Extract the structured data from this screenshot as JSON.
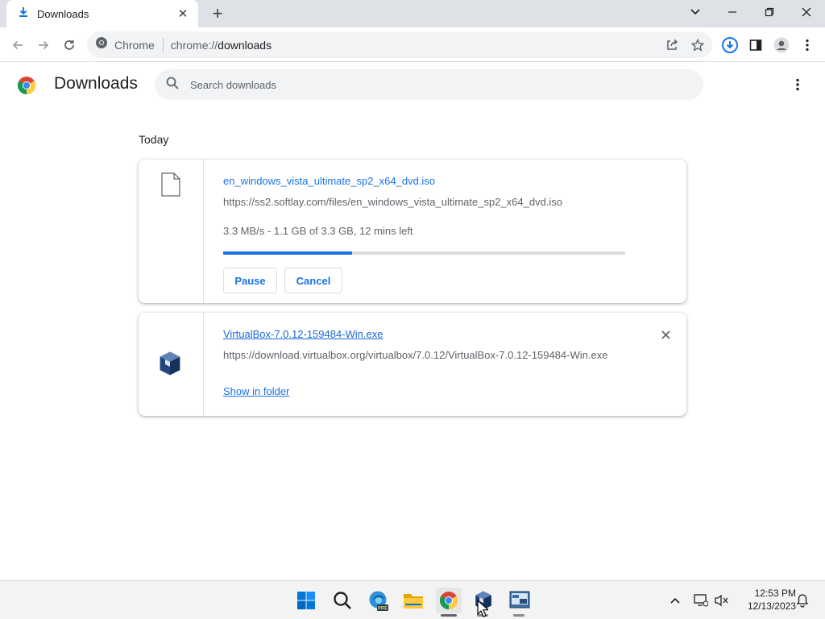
{
  "browser": {
    "tab": {
      "title": "Downloads"
    },
    "omnibox": {
      "site_chip": "Chrome",
      "url_scheme": "chrome://",
      "url_host": "downloads"
    }
  },
  "downloads_page": {
    "title": "Downloads",
    "search_placeholder": "Search downloads",
    "section_date": "Today",
    "items": [
      {
        "file_name": "en_windows_vista_ultimate_sp2_x64_dvd.iso",
        "url": "https://ss2.softlay.com/files/en_windows_vista_ultimate_sp2_x64_dvd.iso",
        "status": "3.3 MB/s - 1.1 GB of 3.3 GB, 12 mins left",
        "progress_fraction": 0.32,
        "pause_label": "Pause",
        "cancel_label": "Cancel",
        "icon": "generic-file-icon"
      },
      {
        "file_name": "VirtualBox-7.0.12-159484-Win.exe",
        "url": "https://download.virtualbox.org/virtualbox/7.0.12/VirtualBox-7.0.12-159484-Win.exe",
        "show_in_folder_label": "Show in folder",
        "icon": "virtualbox-icon"
      }
    ]
  },
  "taskbar": {
    "apps": [
      "windows-start-icon",
      "search-icon",
      "edge-beta-icon",
      "file-explorer-icon",
      "chrome-icon",
      "virtualbox-icon",
      "vista-installer-icon"
    ],
    "time": "12:53 PM",
    "date": "12/13/2023"
  },
  "colors": {
    "accent": "#1a73e8",
    "tabstrip": "#dee1e6",
    "omnibox": "#f1f3f4"
  }
}
